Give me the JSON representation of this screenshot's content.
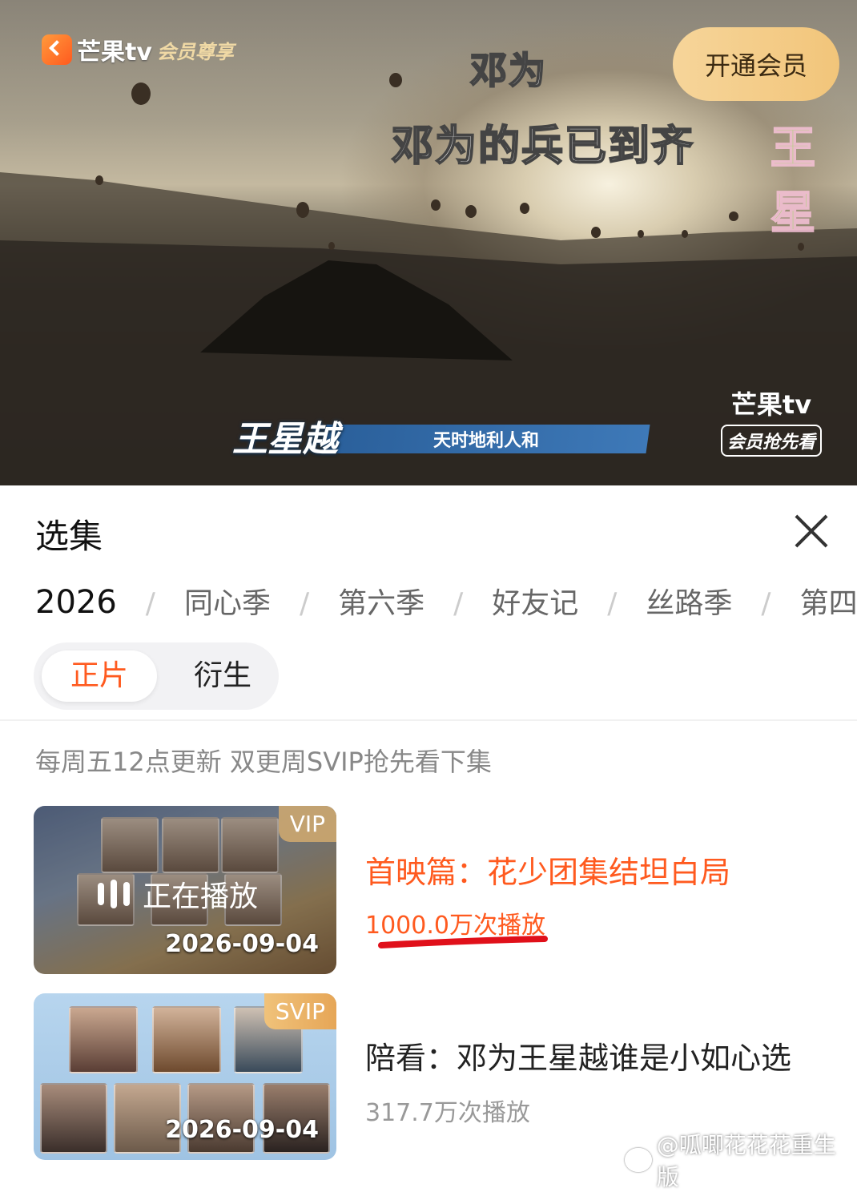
{
  "player": {
    "logo_text": "芒果tv",
    "logo_member": "会员尊享",
    "subtitle_speaker": "邓为",
    "subtitle_line": "邓为的兵已到齐",
    "open_member_label": "开通会员",
    "side_deco_text": "王星",
    "name_card": "王星越",
    "name_motto": "天时地利人和",
    "corner_logo": "芒果tv",
    "corner_logo_sub": "会员抢先看"
  },
  "panel": {
    "title": "选集",
    "seasons": [
      "2026",
      "同心季",
      "第六季",
      "好友记",
      "丝路季",
      "第四季"
    ],
    "segments": [
      "正片",
      "衍生"
    ],
    "update_note": "每周五12点更新 双更周SVIP抢先看下集"
  },
  "episodes": [
    {
      "badge": "VIP",
      "playing_label": "正在播放",
      "date": "2026-09-04",
      "title": "首映篇：花少团集结坦白局",
      "views": "1000.0万次播放"
    },
    {
      "badge": "SVIP",
      "date": "2026-09-04",
      "title": "陪看：邓为王星越谁是小如心选",
      "views": "317.7万次播放"
    }
  ],
  "watermark": "@呱唧花花花重生版",
  "colors": {
    "accent": "#ff5a1f",
    "member_gold": "#f2c57a",
    "annotation_red": "#e0101a"
  }
}
